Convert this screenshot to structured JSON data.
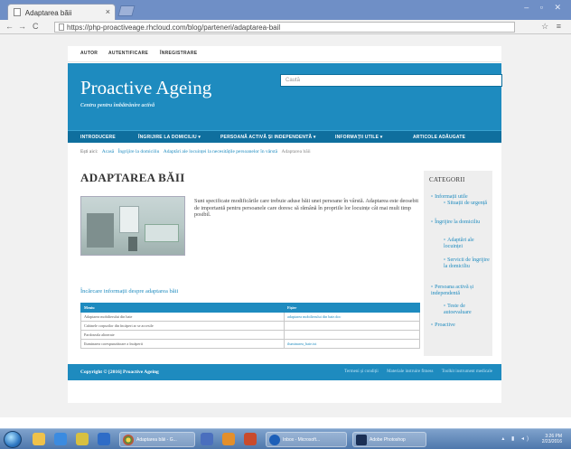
{
  "browser": {
    "tab_title": "Adaptarea băii",
    "tab_close": "×",
    "url": "https://php-proactiveage.rhcloud.com/blog/parteneri/adaptarea-bail",
    "window_controls": "– ▫ ✕",
    "nav_back": "←",
    "nav_forward": "→",
    "nav_reload": "C",
    "tools": "☆ ≡"
  },
  "topnav": {
    "items": [
      "AUTOR",
      "AUTENTIFICARE",
      "ÎNREGISTRARE"
    ]
  },
  "header": {
    "title": "Proactive Ageing",
    "tagline": "Centru pentru îmbătrânire activă",
    "search_placeholder": "Caută"
  },
  "mainnav": {
    "items": [
      "INTRODUCERE",
      "ÎNGRIJIRE LA DOMICILIU ▾",
      "PERSOANĂ ACTIVĂ ȘI INDEPENDENTĂ ▾",
      "INFORMAȚII UTILE ▾",
      "ARTICOLE ADĂUGATE"
    ]
  },
  "breadcrumb": {
    "prefix": "Ești aici:",
    "links": [
      "Acasă",
      "Îngrijire la domiciliu",
      "Adaptări ale locuinței la necesitățile persoanelor în vârstă"
    ],
    "current": "Adaptarea băii"
  },
  "page": {
    "title": "ADAPTAREA BĂII",
    "intro": "Sunt specificate modificările care trebuie aduse băii unei persoane în vârstă. Adaptarea este deosebit de importantă pentru persoanele care doresc să rămână în propriile lor locuințe cât mai mult timp posibil.",
    "download_heading": "Încărcare informații despre adaptarea băii"
  },
  "table": {
    "headers": [
      "Meniu",
      "Fișier"
    ],
    "rows": [
      [
        "Adaptarea mobilierului din baie",
        "adaptarea mobilierului din baie.doc"
      ],
      [
        "Cabinele corpurilor din încăperi ar se accesile",
        ""
      ],
      [
        "Pardoseala alinerate",
        ""
      ],
      [
        "Iluminarea corespunzătoare a încăperii",
        "iluminarea_baie.txt"
      ]
    ]
  },
  "sidebar": {
    "title": "CATEGORII",
    "items": [
      "Informații utile",
      "Situații de urgență",
      "Îngrijire la domiciliu",
      "Adaptări ale locuinței",
      "Servicii de îngrijire la domiciliu",
      "Persoana activă și independentă",
      "Teste de autoevaluare",
      "Proactive"
    ]
  },
  "footer": {
    "copyright": "Copyright © [2016] Proactive Ageing",
    "links": [
      "Termeni și condiții",
      "Materiale instruire fitness",
      "Toolkit instrument medicale"
    ]
  },
  "taskbar": {
    "buttons": [
      "Adaptarea băii - G...",
      "Inbox - Microsoft...",
      "Adobe Photoshop"
    ],
    "time": "3:26 PM",
    "date": "2/23/2016"
  }
}
